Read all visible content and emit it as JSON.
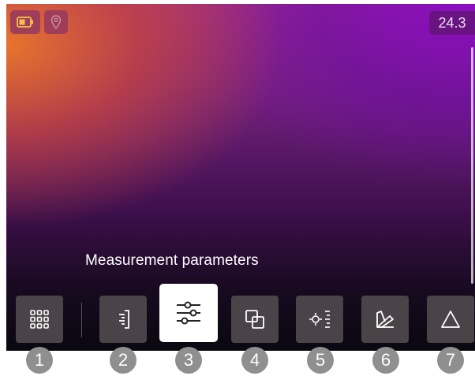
{
  "status_bar": {
    "battery_icon": "battery-icon",
    "location_icon": "location-pin-icon",
    "temperature": "24.3"
  },
  "caption": "Measurement parameters",
  "toolbar": {
    "items": [
      {
        "icon": "grid-menu-icon",
        "active": false
      },
      {
        "icon": "ruler-icon",
        "active": false
      },
      {
        "icon": "sliders-icon",
        "active": true
      },
      {
        "icon": "overlap-squares-icon",
        "active": false
      },
      {
        "icon": "spot-meter-icon",
        "active": false
      },
      {
        "icon": "color-palette-icon",
        "active": false
      },
      {
        "icon": "triangle-icon",
        "active": false
      }
    ]
  },
  "callouts": [
    "1",
    "2",
    "3",
    "4",
    "5",
    "6",
    "7"
  ],
  "colors": {
    "accent_white": "#ffffff",
    "tool_bg": "#4a4448",
    "callout_gray": "#8f8f8f"
  }
}
